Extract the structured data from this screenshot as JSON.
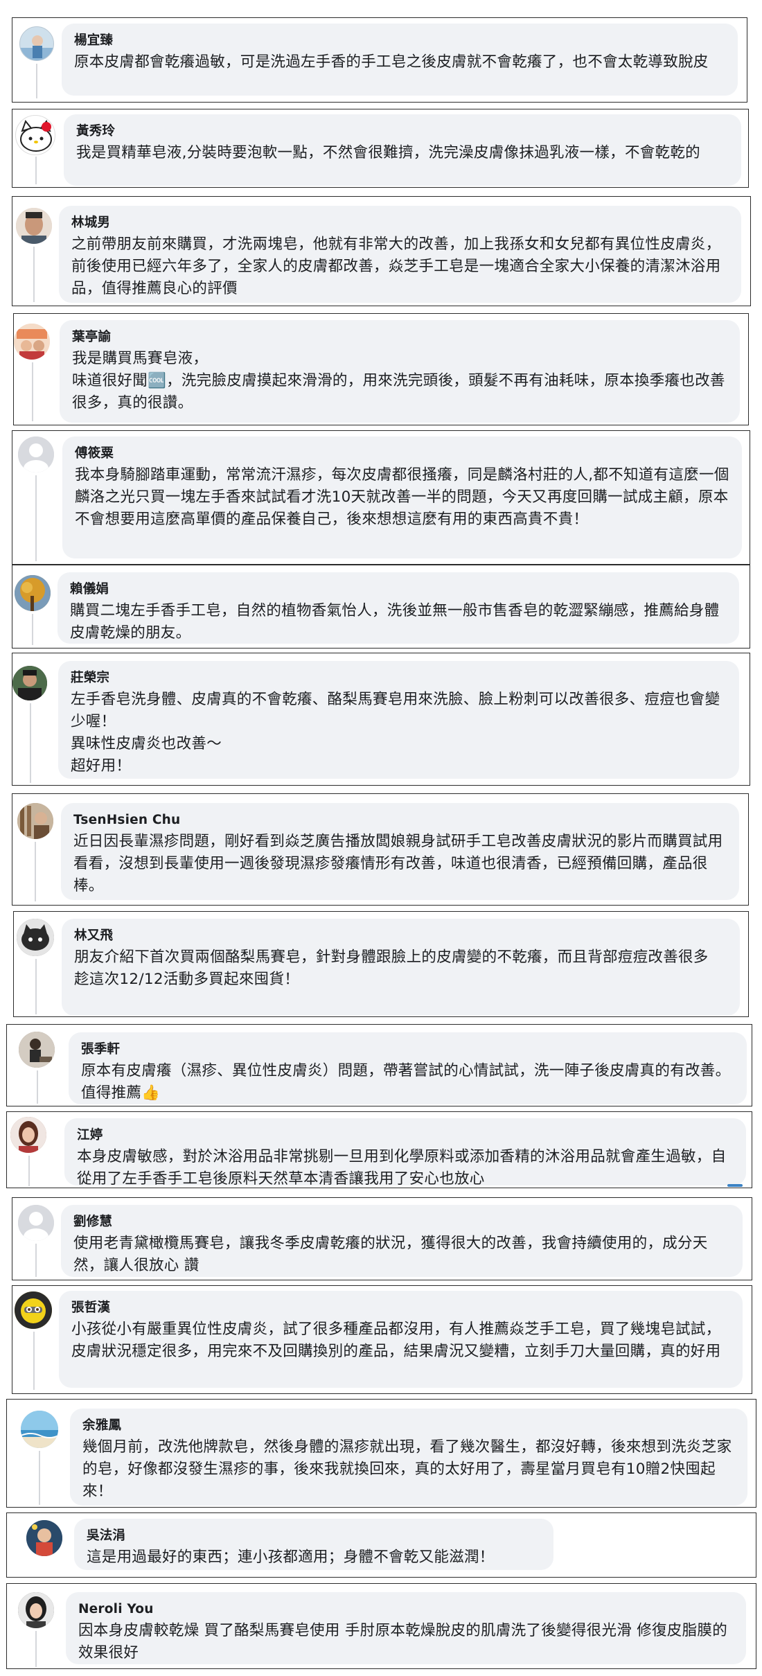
{
  "comments": [
    {
      "name": "楊宜臻",
      "text": "原本皮膚都會乾癢過敏，可是洗過左手香的手工皂之後皮膚就不會乾癢了，也不會太乾導致脫皮",
      "avatar": "avatar-photo-icon",
      "avatar_color": "#7fa8c9"
    },
    {
      "name": "黃秀玲",
      "text": "我是買精華皂液,分裝時要泡軟一點，不然會很難擠，洗完澡皮膚像抹過乳液一樣，不會乾乾的",
      "avatar": "hello-kitty-icon",
      "avatar_color": "#ffffff"
    },
    {
      "name": "林城男",
      "text": "之前帶朋友前來購買，才洗兩塊皂，他就有非常大的改善，加上我孫女和女兒都有異位性皮膚炎，前後使用已經六年多了，全家人的皮膚都改善，焱芝手工皂是一塊適合全家大小保養的清潔沐浴用品，值得推薦良心的評價",
      "avatar": "avatar-photo-icon",
      "avatar_color": "#b98a6e"
    },
    {
      "name": "葉亭諭",
      "text": "我是購買馬賽皂液，\n味道很好聞🆒，洗完臉皮膚摸起來滑滑的，用來洗完頭後，頭髮不再有油耗味，原本換季癢也改善很多，真的很讚。",
      "avatar": "avatar-photo-icon",
      "avatar_color": "#e9a37c"
    },
    {
      "name": "傅筱粟",
      "text": "我本身騎腳踏車運動，常常流汗濕疹，每次皮膚都很搔癢，同是麟洛村莊的人,都不知道有這麼一個麟洛之光只買一塊左手香來試試看才洗10天就改善一半的問題，今天又再度回購一試成主顧，原本不會想要用這麼高單價的產品保養自己，後來想想這麼有用的東西高貴不貴！",
      "avatar": "default-user-icon",
      "avatar_color": "#c8cbd0"
    },
    {
      "name": "賴儀娟",
      "text": "購買二塊左手香手工皂，自然的植物香氣怡人，洗後並無一般市售香皂的乾澀緊繃感，推薦給身體皮膚乾燥的朋友。",
      "avatar": "avatar-photo-icon",
      "avatar_color": "#c9a03e"
    },
    {
      "name": "莊榮宗",
      "text": "左手香皂洗身體、皮膚真的不會乾癢、酪梨馬賽皂用來洗臉、臉上粉刺可以改善很多、痘痘也會變少喔！\n異味性皮膚炎也改善～\n超好用！",
      "avatar": "avatar-photo-icon",
      "avatar_color": "#3c3a36"
    },
    {
      "name": "TsenHsien Chu",
      "text": "近日因長輩濕疹問題，剛好看到焱芝廣告播放闆娘親身試研手工皂改善皮膚狀況的影片而購買試用看看，沒想到長輩使用一週後發現濕疹發癢情形有改善，味道也很清香，已經預備回購，產品很棒。",
      "avatar": "avatar-photo-icon",
      "avatar_color": "#a58a72"
    },
    {
      "name": "林又飛",
      "text": "朋友介紹下首次買兩個酪梨馬賽皂，針對身體跟臉上的皮膚變的不乾癢，而且背部痘痘改善很多\n趁這次12/12活動多買起來囤貨！",
      "avatar": "avatar-photo-icon",
      "avatar_color": "#6d6d6d"
    },
    {
      "name": "張季軒",
      "text": "原本有皮膚癢（濕疹、異位性皮膚炎）問題，帶著嘗試的心情試試，洗一陣子後皮膚真的有改善。值得推薦👍",
      "avatar": "avatar-photo-icon",
      "avatar_color": "#8c7a6a"
    },
    {
      "name": "江婷",
      "text": "本身皮膚敏感，對於沐浴用品非常挑剔一旦用到化學原料或添加香精的沐浴用品就會產生過敏，自從用了左手香手工皂後原料天然草本清香讓我用了安心也放心",
      "avatar": "avatar-photo-icon",
      "avatar_color": "#9b6b58"
    },
    {
      "name": "劉修慧",
      "text": "使用老青黛橄欖馬賽皂，讓我冬季皮膚乾癢的狀況，獲得很大的改善，我會持續使用的，成分天然，讓人很放心 讚",
      "avatar": "default-user-icon",
      "avatar_color": "#c8cbd0"
    },
    {
      "name": "張哲漢",
      "text": "小孩從小有嚴重異位性皮膚炎，試了很多種產品都沒用，有人推薦焱芝手工皂，買了幾塊皂試試，皮膚狀況穩定很多，用完來不及回購換別的產品，結果膚況又變糟，立刻手刀大量回購，真的好用",
      "avatar": "avatar-photo-icon",
      "avatar_color": "#e3c21a"
    },
    {
      "name": "余雅鳳",
      "text": "幾個月前，改洗他牌款皂，然後身體的濕疹就出現，看了幾次醫生，都沒好轉，後來想到洗炎芝家的皂，好像都沒發生濕疹的事，後來我就換回來，真的太好用了，壽星當月買皂有10贈2快囤起來！",
      "avatar": "avatar-photo-icon",
      "avatar_color": "#6fb3d9"
    },
    {
      "name": "吳法涓",
      "text": "這是用過最好的東西；連小孩都適用；身體不會乾又能滋潤！",
      "avatar": "avatar-photo-icon",
      "avatar_color": "#3a6a8c"
    },
    {
      "name": "Neroli You",
      "text": "因本身皮膚較乾燥 買了酪梨馬賽皂使用 手肘原本乾燥脫皮的肌膚洗了後變得很光滑 修復皮脂膜的效果很好",
      "avatar": "avatar-photo-icon",
      "avatar_color": "#4a4a4a"
    }
  ]
}
